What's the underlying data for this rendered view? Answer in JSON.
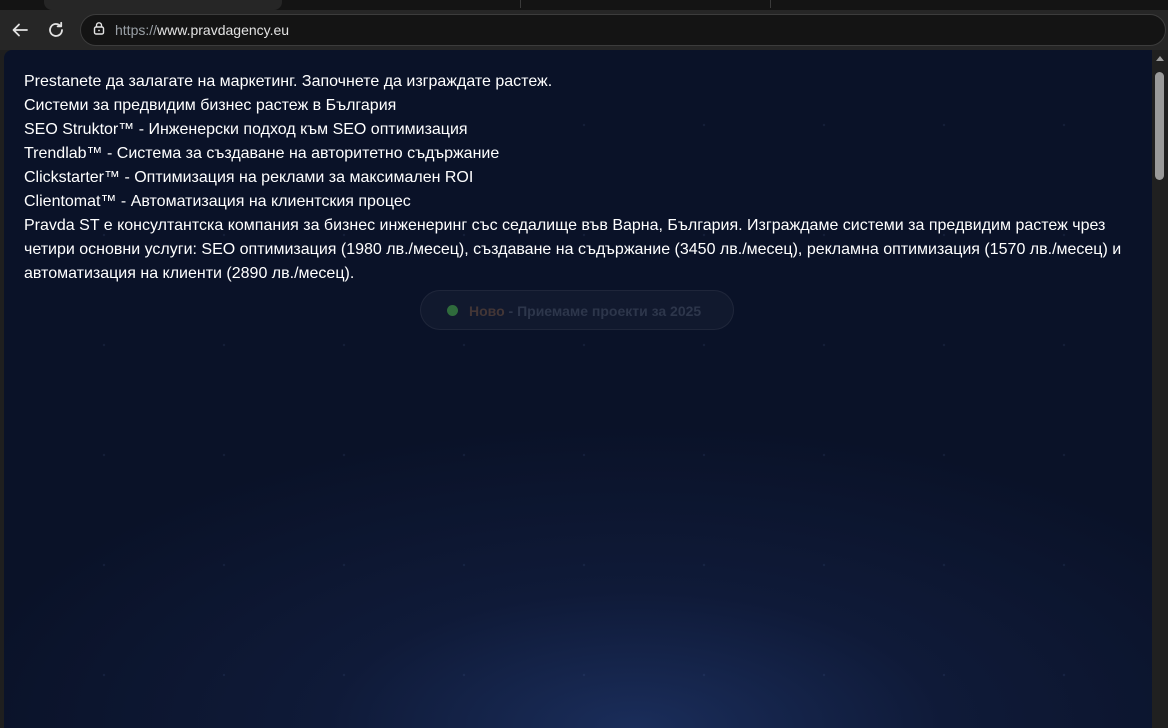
{
  "browser": {
    "url_scheme": "https://",
    "url_host": "www.pravdagency.eu",
    "icons": {
      "back": "arrow-left-icon",
      "reload": "reload-icon",
      "site_info": "lock-icon"
    }
  },
  "page": {
    "lines": [
      "Prestanete да залагате на маркетинг. Започнете да изграждате растеж.",
      "Системи за предвидим бизнес растеж в България",
      "SEO Struktor™ - Инженерски подход към SEO оптимизация",
      "Trendlab™ - Система за създаване на авторитетно съдържание",
      "Clickstarter™ - Оптимизация на реклами за максимален ROI",
      "Clientomat™ - Автоматизация на клиентския процес",
      "Pravda ST е консултантска компания за бизнес инженеринг със седалище във Варна, България. Изграждаме системи за предвидим растеж чрез четири основни услуги: SEO оптимизация (1980 лв./месец), създаване на съдържание (3450 лв./месец), рекламна оптимизация (1570 лв./месец) и автоматизация на клиенти (2890 лв./месец)."
    ],
    "badge": {
      "new_label": "Ново",
      "text": " - Приемаме проекти за 2025"
    },
    "colors": {
      "background": "#0a1228",
      "text": "#ffffff",
      "badge_dot": "#2f6b3c"
    }
  }
}
